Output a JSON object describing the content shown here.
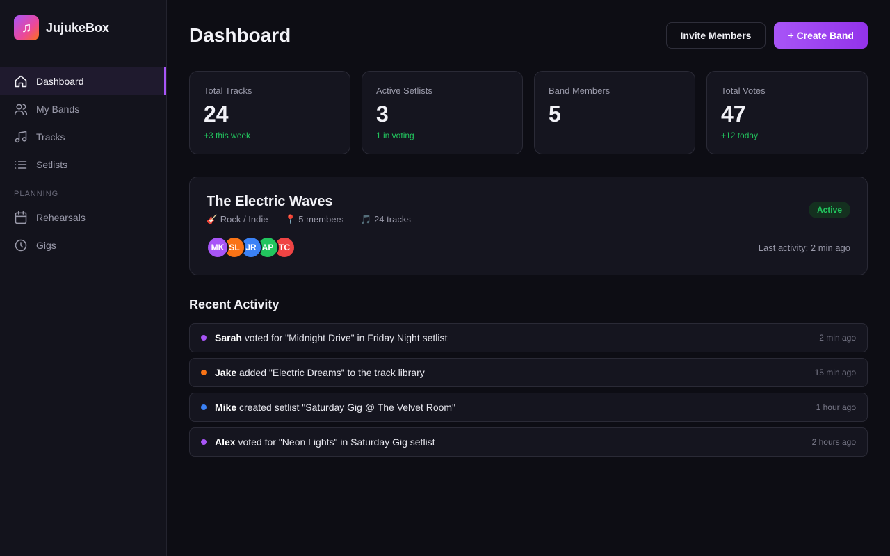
{
  "app": {
    "name": "JujukeBox",
    "logo_icon": "music-note-icon"
  },
  "sidebar": {
    "items": [
      {
        "label": "Dashboard",
        "icon": "home-icon",
        "active": true
      },
      {
        "label": "My Bands",
        "icon": "users-icon",
        "active": false
      },
      {
        "label": "Tracks",
        "icon": "music-icon",
        "active": false
      },
      {
        "label": "Setlists",
        "icon": "list-icon",
        "active": false
      }
    ],
    "section_label": "PLANNING",
    "planning_items": [
      {
        "label": "Rehearsals",
        "icon": "calendar-icon"
      },
      {
        "label": "Gigs",
        "icon": "clock-icon"
      }
    ]
  },
  "header": {
    "title": "Dashboard",
    "invite_label": "Invite Members",
    "create_label": "+ Create Band"
  },
  "stats": [
    {
      "label": "Total Tracks",
      "value": "24",
      "sub": "+3 this week"
    },
    {
      "label": "Active Setlists",
      "value": "3",
      "sub": "1 in voting"
    },
    {
      "label": "Band Members",
      "value": "5",
      "sub": ""
    },
    {
      "label": "Total Votes",
      "value": "47",
      "sub": "+12 today"
    }
  ],
  "band": {
    "name": "The Electric Waves",
    "genre": "🎸 Rock / Indie",
    "members": "📍 5 members",
    "tracks": "🎵 24 tracks",
    "status": "Active",
    "last_activity": "Last activity: 2 min ago",
    "avatars": [
      {
        "initials": "MK",
        "color": "#a855f7"
      },
      {
        "initials": "SL",
        "color": "#f97316"
      },
      {
        "initials": "JR",
        "color": "#3b82f6"
      },
      {
        "initials": "AP",
        "color": "#22c55e"
      },
      {
        "initials": "TC",
        "color": "#ef4444"
      }
    ]
  },
  "recent": {
    "title": "Recent Activity",
    "items": [
      {
        "user": "Sarah",
        "text": " voted for \"Midnight Drive\" in Friday Night setlist",
        "time": "2 min ago",
        "color": "#a855f7"
      },
      {
        "user": "Jake",
        "text": " added \"Electric Dreams\" to the track library",
        "time": "15 min ago",
        "color": "#f97316"
      },
      {
        "user": "Mike",
        "text": " created setlist \"Saturday Gig @ The Velvet Room\"",
        "time": "1 hour ago",
        "color": "#3b82f6"
      },
      {
        "user": "Alex",
        "text": " voted for \"Neon Lights\" in Saturday Gig setlist",
        "time": "2 hours ago",
        "color": "#a855f7"
      }
    ]
  }
}
